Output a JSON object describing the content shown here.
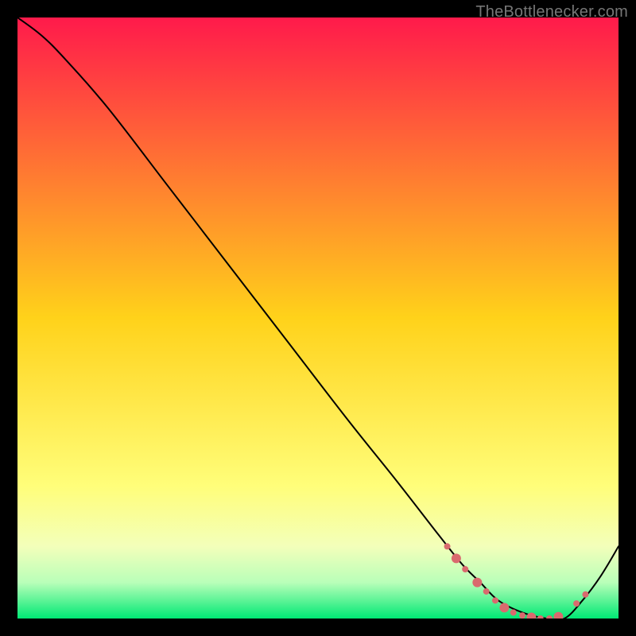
{
  "watermark": "TheBottlenecker.com",
  "chart_data": {
    "type": "line",
    "title": "",
    "xlabel": "",
    "ylabel": "",
    "xlim": [
      0,
      100
    ],
    "ylim": [
      0,
      100
    ],
    "background_gradient": [
      {
        "stop": 0.0,
        "color": "#ff1a4b"
      },
      {
        "stop": 0.5,
        "color": "#ffd21a"
      },
      {
        "stop": 0.78,
        "color": "#fffe7a"
      },
      {
        "stop": 0.88,
        "color": "#f3ffba"
      },
      {
        "stop": 0.94,
        "color": "#b9ffb9"
      },
      {
        "stop": 1.0,
        "color": "#00e874"
      }
    ],
    "series": [
      {
        "name": "curve",
        "stroke": "#000000",
        "stroke_width": 2,
        "x": [
          0,
          4,
          8,
          15,
          25,
          35,
          45,
          55,
          63,
          70,
          74,
          77,
          80,
          84,
          88,
          91,
          94,
          97,
          100
        ],
        "y": [
          100,
          97,
          93,
          85,
          72,
          59,
          46,
          33,
          23,
          14,
          9,
          6,
          3,
          1,
          0,
          0,
          3,
          7,
          12
        ]
      }
    ],
    "markers": {
      "name": "highlight-points",
      "fill": "#d96a6e",
      "radius_small": 4,
      "radius_large": 6,
      "points": [
        {
          "x": 71.5,
          "y": 12.0,
          "r": "small"
        },
        {
          "x": 73.0,
          "y": 10.0,
          "r": "large"
        },
        {
          "x": 74.5,
          "y": 8.2,
          "r": "small"
        },
        {
          "x": 76.5,
          "y": 6.0,
          "r": "large"
        },
        {
          "x": 78.0,
          "y": 4.5,
          "r": "small"
        },
        {
          "x": 79.5,
          "y": 3.0,
          "r": "small"
        },
        {
          "x": 81.0,
          "y": 1.8,
          "r": "large"
        },
        {
          "x": 82.5,
          "y": 1.0,
          "r": "small"
        },
        {
          "x": 84.0,
          "y": 0.5,
          "r": "small"
        },
        {
          "x": 85.5,
          "y": 0.2,
          "r": "large"
        },
        {
          "x": 87.0,
          "y": 0.0,
          "r": "small"
        },
        {
          "x": 88.5,
          "y": 0.0,
          "r": "small"
        },
        {
          "x": 90.0,
          "y": 0.3,
          "r": "large"
        },
        {
          "x": 93.0,
          "y": 2.5,
          "r": "small"
        },
        {
          "x": 94.5,
          "y": 4.0,
          "r": "small"
        }
      ]
    }
  }
}
